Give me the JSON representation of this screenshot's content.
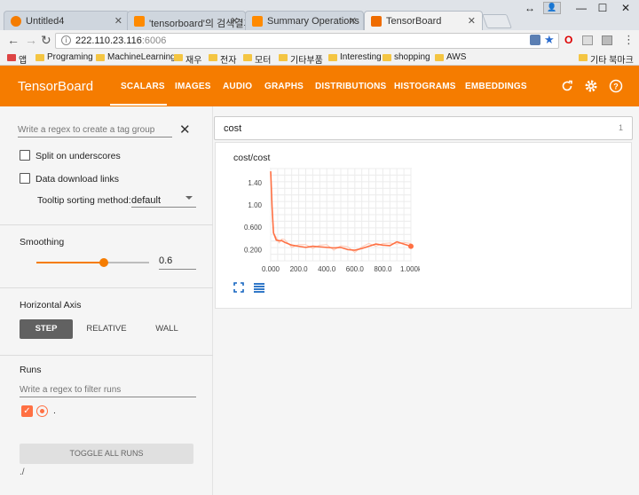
{
  "browser": {
    "tabs": [
      {
        "title": "Untitled4",
        "active": false
      },
      {
        "title": "'tensorboard'의 검색결과",
        "active": false
      },
      {
        "title": "Summary Operations | T",
        "active": false
      },
      {
        "title": "TensorBoard",
        "active": true
      }
    ],
    "url_host": "222.110.23.116",
    "url_rest": ":6006",
    "bookmarks": [
      "앱",
      "Programing",
      "MachineLearning",
      "재우",
      "전자",
      "모터",
      "기타부품",
      "Interesting",
      "shopping",
      "AWS",
      "기타 북마크"
    ]
  },
  "tensorboard": {
    "brand": "TensorBoard",
    "tabs": [
      "SCALARS",
      "IMAGES",
      "AUDIO",
      "GRAPHS",
      "DISTRIBUTIONS",
      "HISTOGRAMS",
      "EMBEDDINGS"
    ],
    "active_tab": "SCALARS",
    "colors": {
      "header": "#f57c00",
      "series": "#ff7043",
      "accent": "#f57c00"
    }
  },
  "sidebar": {
    "regex_placeholder": "Write a regex to create a tag group",
    "split_label": "Split on underscores",
    "download_label": "Data download links",
    "tooltip_label": "Tooltip sorting method:",
    "tooltip_value": "default",
    "smoothing_title": "Smoothing",
    "smoothing_value": "0.6",
    "smoothing_level": 0.6,
    "axis_title": "Horizontal Axis",
    "axis_options": [
      "STEP",
      "RELATIVE",
      "WALL"
    ],
    "axis_selected": "STEP",
    "runs_title": "Runs",
    "runs_placeholder": "Write a regex to filter runs",
    "run_name": ".",
    "toggle_label": "TOGGLE ALL RUNS",
    "log_dir": "./"
  },
  "main": {
    "category": "cost",
    "category_count": "1",
    "chart_title": "cost/cost"
  },
  "chart_data": {
    "type": "line",
    "title": "cost/cost",
    "xlabel": "",
    "ylabel": "",
    "xlim": [
      0,
      1000
    ],
    "ylim": [
      0,
      1.65
    ],
    "x_ticks": [
      "0.000",
      "200.0",
      "400.0",
      "600.0",
      "800.0",
      "1.000k"
    ],
    "y_ticks": [
      "0.200",
      "0.600",
      "1.00",
      "1.40"
    ],
    "series": [
      {
        "x": [
          0,
          10,
          20,
          40,
          60,
          80,
          100,
          150,
          200,
          250,
          300,
          350,
          400,
          450,
          500,
          550,
          600,
          650,
          700,
          750,
          800,
          850,
          900,
          950,
          1000
        ],
        "values": [
          1.6,
          0.95,
          0.5,
          0.37,
          0.36,
          0.36,
          0.33,
          0.28,
          0.26,
          0.24,
          0.26,
          0.25,
          0.24,
          0.23,
          0.24,
          0.2,
          0.19,
          0.22,
          0.26,
          0.3,
          0.28,
          0.27,
          0.34,
          0.3,
          0.26
        ]
      }
    ]
  }
}
